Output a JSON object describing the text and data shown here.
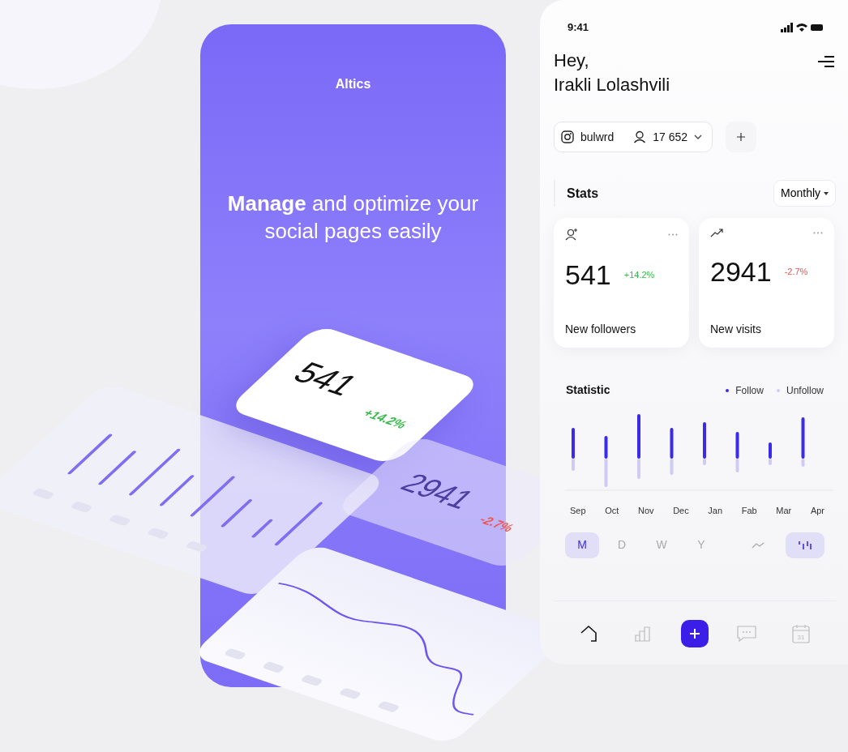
{
  "promo": {
    "brand": "Altics",
    "headline": "**Manage** and optimize your social pages easily",
    "cards": [
      {
        "value": "541",
        "change": "+14.2%",
        "color": "#35b94b"
      },
      {
        "value": "2941",
        "change": "-2.7%",
        "color": "#ef5350"
      }
    ]
  },
  "app": {
    "status_bar": {
      "time": "9:41"
    },
    "greeting": "Hey,",
    "user_name": "Irakli Lolashvili",
    "account": {
      "handle": "bulwrd",
      "followers": "17 652"
    },
    "stats": {
      "title": "Stats",
      "period": "Monthly",
      "cards": [
        {
          "kind": "followers",
          "value": "541",
          "change": "+14.2%",
          "color": "#35b94b",
          "label": "New followers"
        },
        {
          "kind": "visits",
          "value": "2941",
          "change": "-2.7%",
          "color": "#ef5350",
          "label": "New visits"
        }
      ]
    },
    "statistic": {
      "title": "Statistic",
      "legend": [
        {
          "label": "Follow",
          "color": "#3b2be8"
        },
        {
          "label": "Unfollow",
          "color": "#cfcbf3"
        }
      ],
      "months": [
        "Sep",
        "Oct",
        "Nov",
        "Dec",
        "Jan",
        "Fab",
        "Mar",
        "Apr"
      ],
      "ranges": [
        {
          "label": "M",
          "selected": true
        },
        {
          "label": "D",
          "selected": false
        },
        {
          "label": "W",
          "selected": false
        },
        {
          "label": "Y",
          "selected": false
        }
      ],
      "chart_types": [
        {
          "kind": "line",
          "selected": false
        },
        {
          "kind": "bar",
          "selected": true
        }
      ]
    },
    "tab_bar": [
      {
        "kind": "home",
        "selected": true
      },
      {
        "kind": "stats",
        "selected": false
      },
      {
        "kind": "messages",
        "selected": false
      },
      {
        "kind": "calendar",
        "selected": false,
        "day": "31"
      }
    ]
  }
}
